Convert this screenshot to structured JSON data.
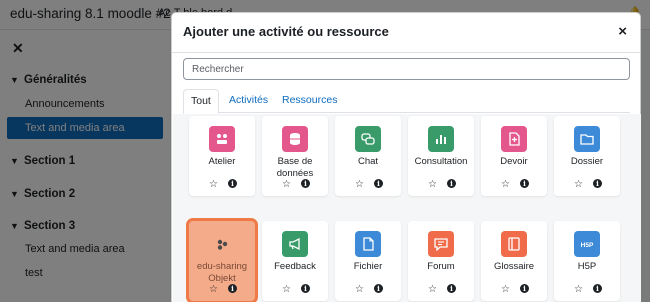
{
  "site": {
    "name": "edu-sharing 8.1 moodle #2",
    "nav_partial": "Ac    T  ble    bord    d"
  },
  "drawer": {
    "sections": [
      {
        "label": "Généralités"
      },
      {
        "label": "Section 1"
      },
      {
        "label": "Section 2"
      },
      {
        "label": "Section 3"
      }
    ],
    "items": [
      {
        "label": "Announcements"
      },
      {
        "label": "Text and media area"
      },
      {
        "label": "Text and media area"
      },
      {
        "label": "test"
      }
    ]
  },
  "modal": {
    "title": "Ajouter une activité ou ressource",
    "close": "×",
    "search_placeholder": "Rechercher",
    "tabs": [
      "Tout",
      "Activités",
      "Ressources"
    ],
    "star": "☆",
    "info": "i",
    "activities": [
      {
        "name": "Atelier",
        "color": "#e4578c",
        "icon": "workshop-icon"
      },
      {
        "name": "Base de données",
        "color": "#e4578c",
        "icon": "database-icon"
      },
      {
        "name": "Chat",
        "color": "#399b6a",
        "icon": "chat-icon"
      },
      {
        "name": "Consultation",
        "color": "#399b6a",
        "icon": "chart-icon"
      },
      {
        "name": "Devoir",
        "color": "#e4578c",
        "icon": "assignment-icon"
      },
      {
        "name": "Dossier",
        "color": "#3c8ad8",
        "icon": "folder-icon"
      },
      {
        "name": "edu-sharing Objekt",
        "color": "#f4ab8a",
        "icon": "edu-sharing-icon"
      },
      {
        "name": "Feedback",
        "color": "#399b6a",
        "icon": "megaphone-icon"
      },
      {
        "name": "Fichier",
        "color": "#3c8ad8",
        "icon": "file-icon"
      },
      {
        "name": "Forum",
        "color": "#ef6b4a",
        "icon": "forum-icon"
      },
      {
        "name": "Glossaire",
        "color": "#ef6b4a",
        "icon": "glossary-icon"
      },
      {
        "name": "H5P",
        "color": "#3c8ad8",
        "icon": "h5p-icon"
      }
    ]
  }
}
